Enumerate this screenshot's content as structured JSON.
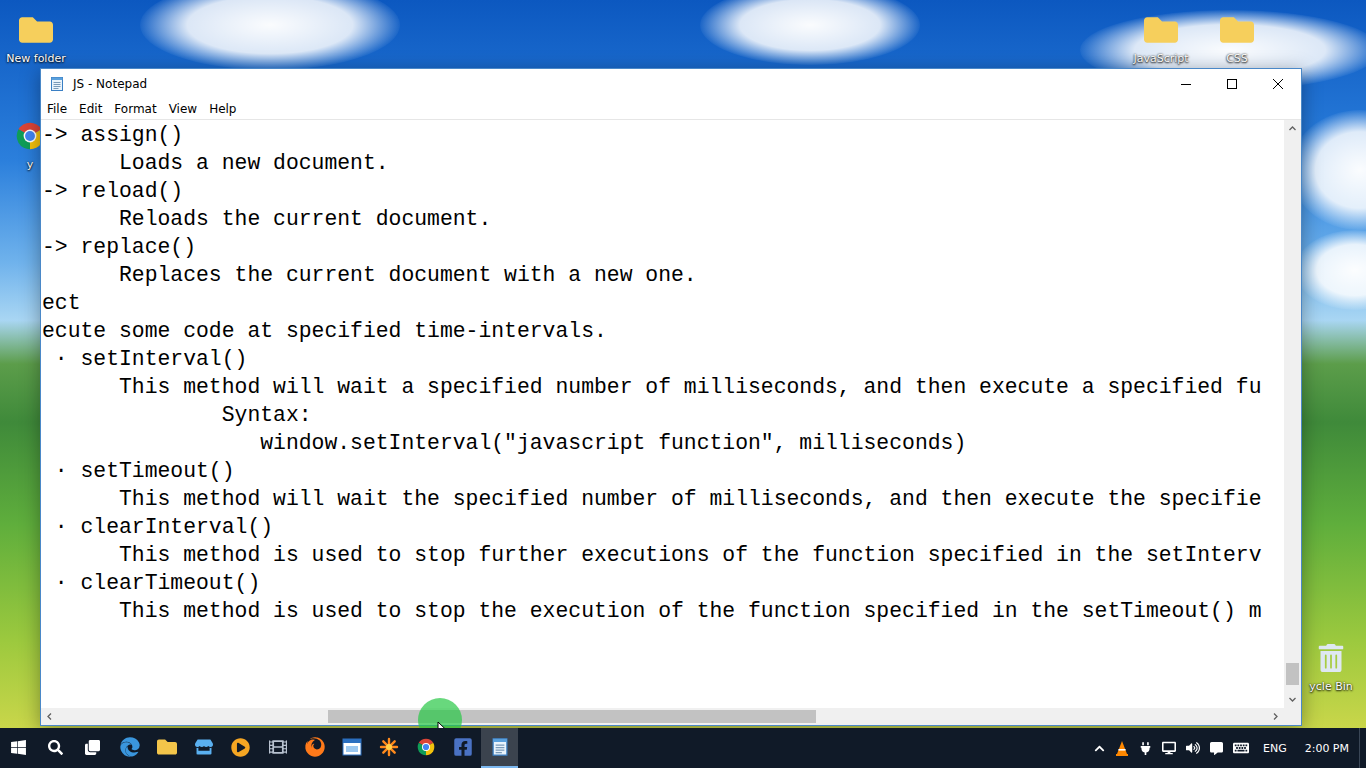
{
  "desktop": {
    "icons": [
      {
        "label": "New folder",
        "kind": "folder"
      },
      {
        "label": "JavaScript",
        "kind": "folder"
      },
      {
        "label": "CSS",
        "kind": "folder"
      },
      {
        "label": "y",
        "kind": "chrome"
      },
      {
        "label": "ycle Bin",
        "kind": "bin"
      }
    ]
  },
  "window": {
    "title": "JS - Notepad",
    "menu": [
      "File",
      "Edit",
      "Format",
      "View",
      "Help"
    ],
    "lines": [
      "-> assign()",
      "      Loads a new document.",
      "-> reload()",
      "      Reloads the current document.",
      "-> replace()",
      "      Replaces the current document with a new one.",
      "ect",
      "ecute some code at specified time-intervals.",
      " · setInterval()",
      "      This method will wait a specified number of milliseconds, and then execute a specified fu",
      "              Syntax:",
      "                 window.setInterval(\"javascript function\", milliseconds)",
      " · setTimeout()",
      "      This method will wait the specified number of milliseconds, and then execute the specifie",
      " · clearInterval()",
      "      This method is used to stop further executions of the function specified in the setInterv",
      " · clearTimeout()",
      "      This method is used to stop the execution of the function specified in the setTimeout() m"
    ],
    "scrollbars": {
      "horizontal": {
        "offset": 0.223,
        "level": 0.404
      },
      "vertical": {
        "offset": 0.955,
        "level": 0.04
      }
    }
  },
  "taskbar": {
    "apps": [
      {
        "kind": "start",
        "active": false
      },
      {
        "kind": "search",
        "active": false
      },
      {
        "kind": "taskview",
        "active": false
      },
      {
        "kind": "edge",
        "active": false
      },
      {
        "kind": "explorer",
        "active": false
      },
      {
        "kind": "store",
        "active": false
      },
      {
        "kind": "media",
        "active": false
      },
      {
        "kind": "film",
        "active": false
      },
      {
        "kind": "firefox",
        "active": false
      },
      {
        "kind": "window",
        "active": false
      },
      {
        "kind": "star",
        "active": false
      },
      {
        "kind": "chrome",
        "active": false
      },
      {
        "kind": "facebook",
        "active": false
      },
      {
        "kind": "notepad",
        "active": true
      }
    ],
    "language": "ENG",
    "time": "2:00 PM"
  }
}
